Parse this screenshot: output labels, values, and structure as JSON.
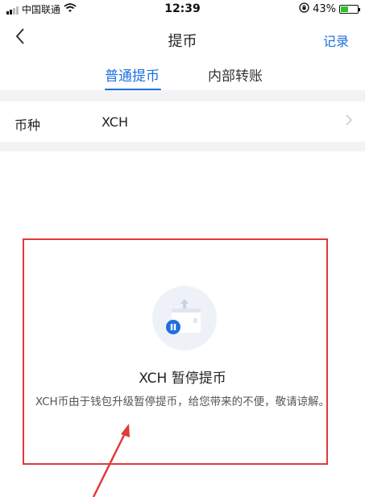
{
  "status_bar": {
    "carrier": "中国联通",
    "time": "12:39",
    "battery_percent": "43%",
    "battery_level": 0.43,
    "signal_icon": "signal-bars-icon",
    "wifi_icon": "wifi-icon",
    "orientation_lock_icon": "orientation-lock-icon",
    "battery_icon": "battery-charging-icon"
  },
  "nav": {
    "back_icon": "chevron-left-icon",
    "title": "提币",
    "record_label": "记录"
  },
  "tabs": [
    {
      "label": "普通提币",
      "active": true
    },
    {
      "label": "内部转账",
      "active": false
    }
  ],
  "coin_row": {
    "label": "币种",
    "value": "XCH",
    "chevron_icon": "chevron-right-icon"
  },
  "notice": {
    "icon": "withdraw-paused-icon",
    "title": "XCH 暂停提币",
    "description": "XCH币由于钱包升级暂停提币，给您带来的不便，敬请谅解。"
  },
  "colors": {
    "accent": "#1e6fe0",
    "annotation_red": "#e03a3a",
    "separator": "#f2f3f5"
  }
}
